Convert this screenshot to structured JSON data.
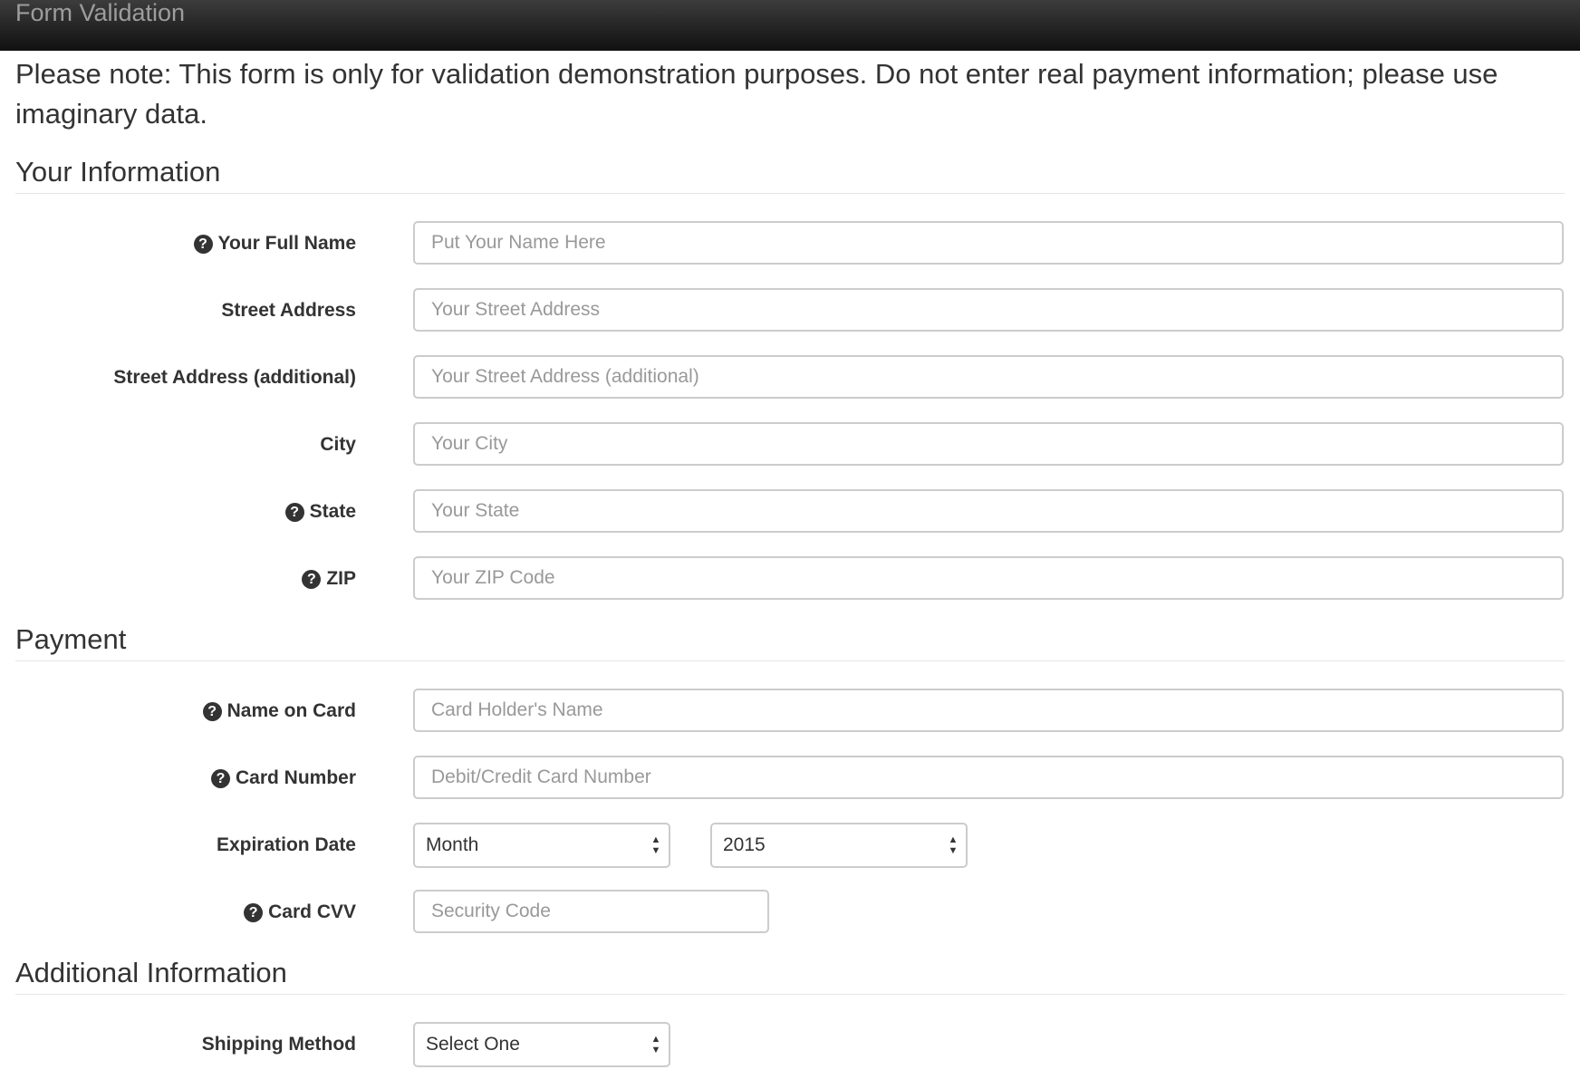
{
  "header": {
    "title": "Form Validation"
  },
  "note": "Please note: This form is only for validation demonstration purposes. Do not enter real payment information; please use imaginary data.",
  "sections": {
    "your_info": {
      "title": "Your Information",
      "fields": {
        "full_name": {
          "label": "Your Full Name",
          "placeholder": "Put Your Name Here"
        },
        "street": {
          "label": "Street Address",
          "placeholder": "Your Street Address"
        },
        "street2": {
          "label": "Street Address (additional)",
          "placeholder": "Your Street Address (additional)"
        },
        "city": {
          "label": "City",
          "placeholder": "Your City"
        },
        "state": {
          "label": "State",
          "placeholder": "Your State"
        },
        "zip": {
          "label": "ZIP",
          "placeholder": "Your ZIP Code"
        }
      }
    },
    "payment": {
      "title": "Payment",
      "fields": {
        "card_name": {
          "label": "Name on Card",
          "placeholder": "Card Holder's Name"
        },
        "card_number": {
          "label": "Card Number",
          "placeholder": "Debit/Credit Card Number"
        },
        "expiration": {
          "label": "Expiration Date",
          "month_value": "Month",
          "year_value": "2015"
        },
        "cvv": {
          "label": "Card CVV",
          "placeholder": "Security Code"
        }
      }
    },
    "additional": {
      "title": "Additional Information",
      "fields": {
        "shipping": {
          "label": "Shipping Method",
          "value": "Select One"
        }
      }
    }
  },
  "icons": {
    "help": "question-circle-icon",
    "help_glyph": "?",
    "select_arrows": "up-down-arrows-icon"
  }
}
